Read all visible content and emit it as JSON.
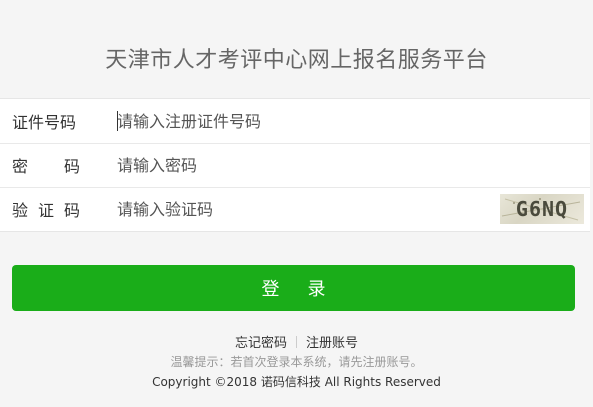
{
  "header": {
    "title": "天津市人才考评中心网上报名服务平台"
  },
  "form": {
    "id_number": {
      "label": "证件号码",
      "placeholder": "请输入注册证件号码",
      "value": ""
    },
    "password": {
      "label_chars": [
        "密",
        "码"
      ],
      "placeholder": "请输入密码",
      "value": ""
    },
    "captcha": {
      "label_chars": [
        "验",
        "证",
        "码"
      ],
      "placeholder": "请输入验证码",
      "value": "",
      "image_text": "G6NQ"
    }
  },
  "login_button": {
    "label": "登录"
  },
  "links": {
    "forgot_password": "忘记密码",
    "register": "注册账号"
  },
  "tip": "温馨提示：若首次登录本系统，请先注册账号。",
  "copyright": "Copyright ©2018 诺码信科技 All Rights Reserved",
  "colors": {
    "primary_button": "#1aad19",
    "background": "#f5f5f5"
  }
}
